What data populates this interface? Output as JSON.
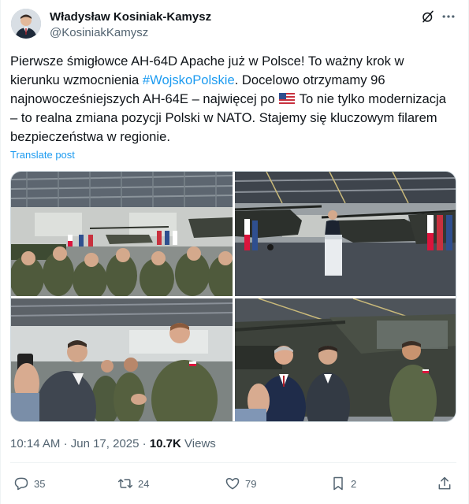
{
  "author": {
    "name": "Władysław Kosiniak-Kamysz",
    "handle": "@KosiniakKamysz"
  },
  "post": {
    "text_part1": "Pierwsze śmigłowce AH-64D Apache już w Polsce! To ważny krok w kierunku wzmocnienia ",
    "hashtag": "#WojskoPolskie",
    "text_part2": ". Docelowo otrzymamy 96 najnowocześniejszych AH-64E – najwięcej po ",
    "flag_icon": "us-flag-emoji",
    "text_part3": " To nie tylko modernizacja – to realna zmiana pozycji Polski w NATO. Stajemy się kluczowym filarem bezpieczeństwa w regionie.",
    "translate_label": "Translate post"
  },
  "media": [
    {
      "icon": "photo-soldiers-in-hangar"
    },
    {
      "icon": "photo-speaker-at-podium-apache"
    },
    {
      "icon": "photo-handshake-with-soldier"
    },
    {
      "icon": "photo-officials-with-pilot"
    }
  ],
  "meta": {
    "time": "10:14 AM",
    "separator": "·",
    "date": "Jun 17, 2025",
    "views_count": "10.7K",
    "views_label": "Views"
  },
  "actions": {
    "replies": "35",
    "reposts": "24",
    "likes": "79",
    "bookmarks": "2"
  },
  "colors": {
    "accent": "#1d9bf0",
    "muted": "#536471",
    "text": "#0f1419"
  }
}
